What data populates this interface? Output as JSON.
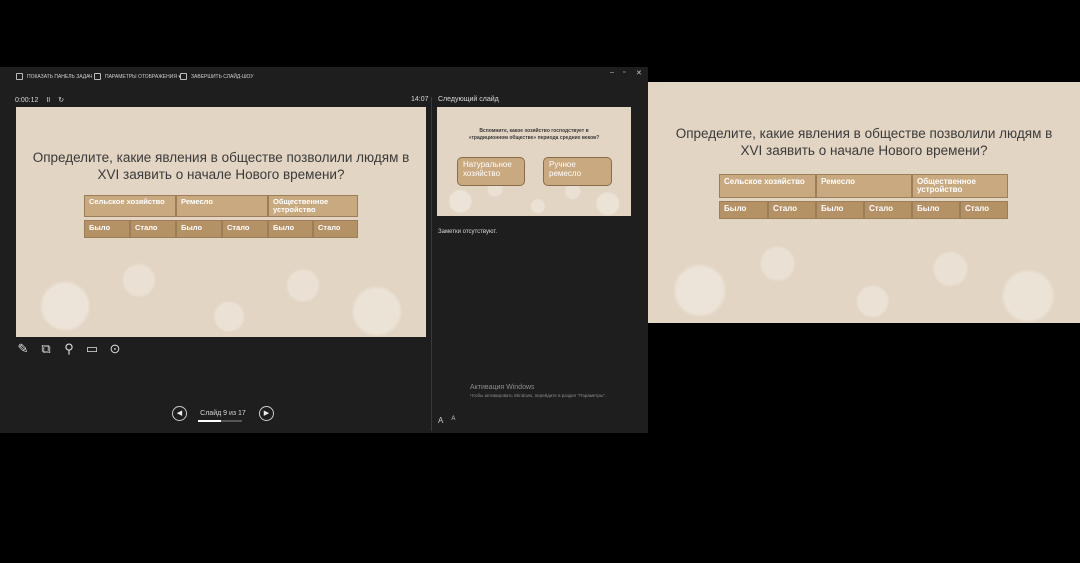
{
  "toolbar": {
    "show_taskbar": "ПОКАЗАТЬ ПАНЕЛЬ ЗАДАЧ",
    "display_settings": "ПАРАМЕТРЫ ОТОБРАЖЕНИЯ ▾",
    "end_show": "ЗАВЕРШИТЬ СЛАЙД-ШОУ"
  },
  "window_controls": {
    "minimize": "–",
    "restore": "▫",
    "close": "✕"
  },
  "timer": {
    "elapsed": "0:00:12",
    "pause": "II",
    "reset": "↻",
    "clock": "14:07"
  },
  "next_slide_label": "Следующий слайд",
  "slide": {
    "title_line1": "Определите, какие явления в обществе позволили людям в",
    "title_line2": "XVI заявить о начале Нового времени?",
    "headers": [
      "Сельское хозяйство",
      "Ремесло",
      "Общественное устройство"
    ],
    "subheaders": [
      "Было",
      "Стало",
      "Было",
      "Стало",
      "Было",
      "Стало"
    ]
  },
  "next_slide": {
    "question_line1": "Вспомните, какое хозяйство господствует в",
    "question_line2": "«традиционном обществе» периода средних веков?",
    "option1": "Натуральное хозяйство",
    "option2": "Ручное ремесло"
  },
  "notes_text": "Заметки отсутствуют.",
  "tools": [
    "pen-icon",
    "laser-pointer-icon",
    "zoom-icon",
    "screen-icon",
    "more-icon"
  ],
  "navigation": {
    "prev": "◀",
    "next": "▶",
    "counter": "Слайд 9 из 17",
    "progress": 0.53
  },
  "activation": {
    "title": "Активация Windows",
    "subtitle": "Чтобы активировать Windows, перейдите в раздел \"Параметры\"."
  },
  "font_buttons": {
    "increase": "A",
    "decrease": "A"
  },
  "colors": {
    "slide_bg": "#e2d5c3",
    "table_cell": "#c9a97f",
    "window_bg": "#1e1e1e"
  }
}
